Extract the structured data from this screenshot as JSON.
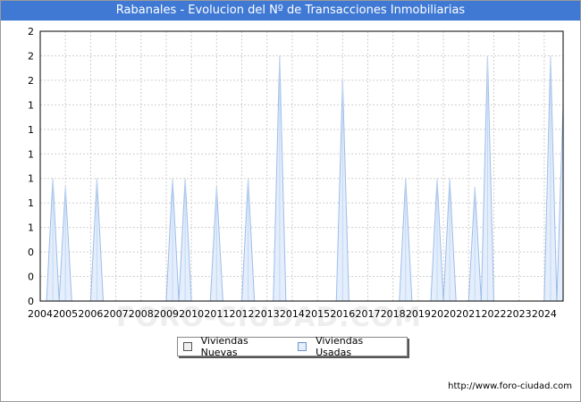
{
  "title": "Rabanales - Evolucion del Nº de Transacciones Inmobiliarias",
  "watermark": "FORO-CIUDAD.COM",
  "url": "http://www.foro-ciudad.com",
  "colors": {
    "title_bg": "#3f79d4",
    "nuevas": "#f0f0f0",
    "usadas": "#e4eefc",
    "usadas_stroke": "#9dbde8"
  },
  "chart_data": {
    "type": "area",
    "title": "Rabanales - Evolucion del Nº de Transacciones Inmobiliarias",
    "xlabel": "",
    "ylabel": "",
    "x_ticks": [
      "2004",
      "2005",
      "2006",
      "2007",
      "2008",
      "2009",
      "2010",
      "2011",
      "2012",
      "2013",
      "2014",
      "2015",
      "2016",
      "2017",
      "2018",
      "2019",
      "2020",
      "2021",
      "2022",
      "2023",
      "2024"
    ],
    "y_tick_labels": [
      "0",
      "0",
      "0",
      "1",
      "1",
      "1",
      "1",
      "1",
      "1",
      "2",
      "2",
      "2"
    ],
    "xlim": [
      2004,
      2024.75
    ],
    "ylim": [
      0,
      2.2
    ],
    "grid": true,
    "legend_position": "bottom",
    "series": [
      {
        "name": "Viviendas Nuevas",
        "points": []
      },
      {
        "name": "Viviendas Usadas",
        "points": [
          {
            "x": 2004.5,
            "y": 1
          },
          {
            "x": 2005.0,
            "y": 0.93
          },
          {
            "x": 2006.25,
            "y": 1
          },
          {
            "x": 2009.25,
            "y": 1
          },
          {
            "x": 2009.75,
            "y": 1
          },
          {
            "x": 2011.0,
            "y": 0.93
          },
          {
            "x": 2012.25,
            "y": 1
          },
          {
            "x": 2013.5,
            "y": 2
          },
          {
            "x": 2016.0,
            "y": 1.8
          },
          {
            "x": 2018.5,
            "y": 1
          },
          {
            "x": 2019.75,
            "y": 1
          },
          {
            "x": 2020.25,
            "y": 1
          },
          {
            "x": 2021.25,
            "y": 0.93
          },
          {
            "x": 2021.75,
            "y": 2
          },
          {
            "x": 2024.25,
            "y": 2
          },
          {
            "x": 2024.75,
            "y": 1.6
          }
        ]
      }
    ]
  }
}
